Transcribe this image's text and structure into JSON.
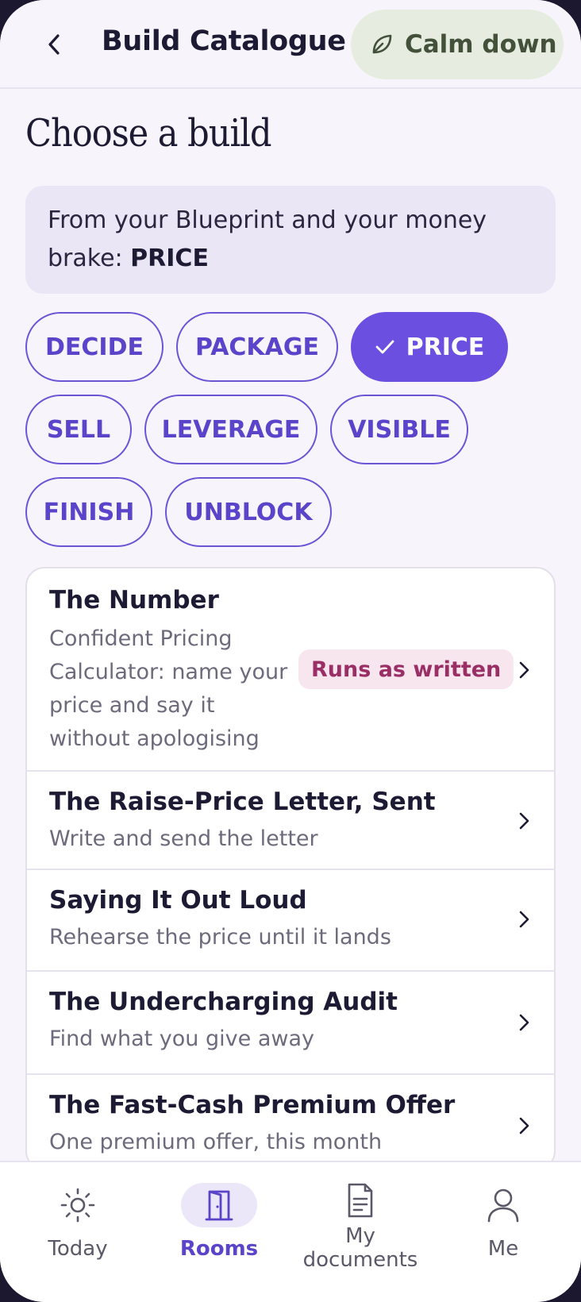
{
  "header": {
    "back_icon": "chevron-left-icon",
    "title": "Build Catalogue",
    "calm_button": {
      "label": "Calm down",
      "icon": "leaf-icon"
    }
  },
  "page": {
    "title": "Choose a build",
    "info_prefix": "From your Blueprint and your money brake: ",
    "info_highlight": "PRICE"
  },
  "chips": [
    {
      "label": "DECIDE",
      "selected": false
    },
    {
      "label": "PACKAGE",
      "selected": false
    },
    {
      "label": "PRICE",
      "selected": true
    },
    {
      "label": "SELL",
      "selected": false
    },
    {
      "label": "LEVERAGE",
      "selected": false
    },
    {
      "label": "VISIBLE",
      "selected": false
    },
    {
      "label": "FINISH",
      "selected": false
    },
    {
      "label": "UNBLOCK",
      "selected": false
    }
  ],
  "builds": [
    {
      "title": "The Number",
      "subtitle_lines": [
        "Confident Pricing",
        "Calculator: name your",
        "price and say it",
        "without apologising"
      ],
      "badge": "Runs as written"
    },
    {
      "title": "The Raise-Price Letter, Sent",
      "subtitle": "Write and send the letter"
    },
    {
      "title": "Saying It Out Loud",
      "subtitle": "Rehearse the price until it lands"
    },
    {
      "title": "The Undercharging Audit",
      "subtitle": "Find what you give away"
    },
    {
      "title": "The Fast-Cash Premium Offer",
      "subtitle": "One premium offer, this month"
    }
  ],
  "nav": [
    {
      "label": "Today",
      "icon": "sun-icon",
      "active": false
    },
    {
      "label": "Rooms",
      "icon": "door-icon",
      "active": true
    },
    {
      "label_line1": "My",
      "label_line2": "documents",
      "icon": "document-icon",
      "active": false
    },
    {
      "label": "Me",
      "icon": "user-icon",
      "active": false
    }
  ],
  "colors": {
    "accent": "#6a4fe0",
    "background": "#f7f5fb",
    "calm_bg": "#e6ece0",
    "badge_bg": "#f8e6ef",
    "badge_text": "#9a2f66"
  }
}
